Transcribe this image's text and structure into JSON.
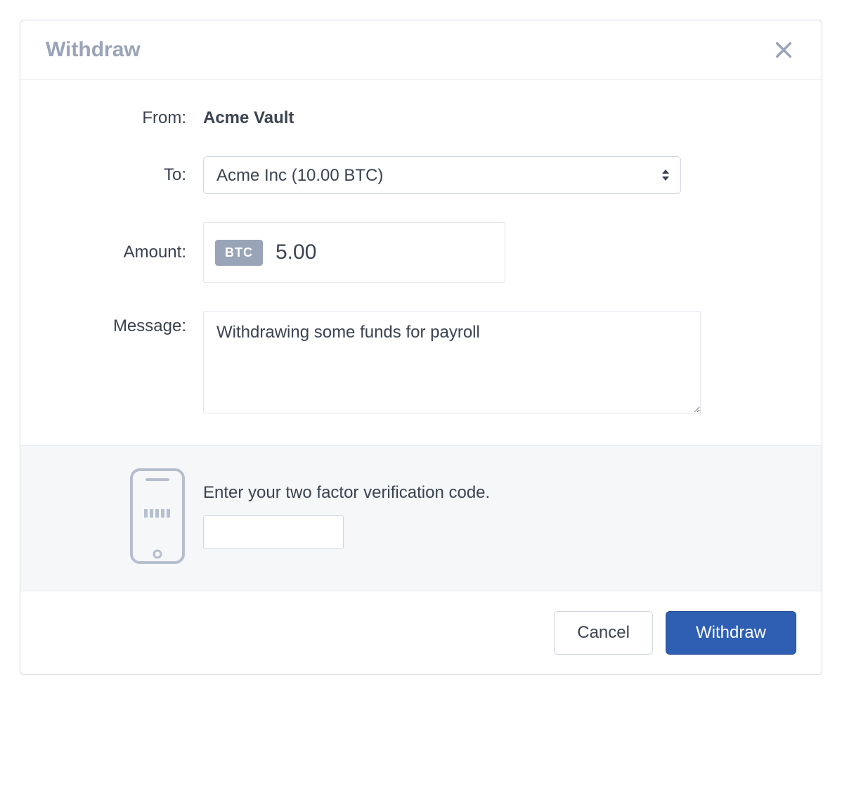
{
  "header": {
    "title": "Withdraw"
  },
  "form": {
    "from_label": "From:",
    "from_value": "Acme Vault",
    "to_label": "To:",
    "to_value": "Acme Inc (10.00 BTC)",
    "amount_label": "Amount:",
    "amount_currency": "BTC",
    "amount_value": "5.00",
    "message_label": "Message:",
    "message_value": "Withdrawing some funds for payroll"
  },
  "twofa": {
    "label": "Enter your two factor verification code.",
    "value": ""
  },
  "footer": {
    "cancel_label": "Cancel",
    "submit_label": "Withdraw"
  }
}
